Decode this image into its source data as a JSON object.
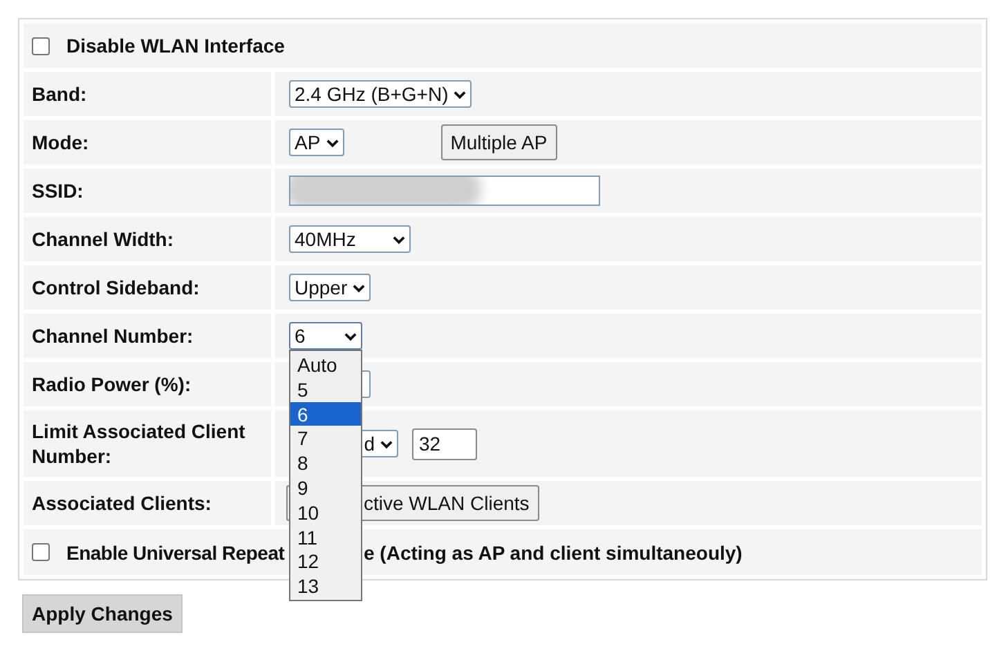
{
  "disable_wlan": {
    "label": "Disable WLAN Interface",
    "checked": false
  },
  "fields": [
    {
      "kind": "select",
      "label": "Band:",
      "value": "2.4 GHz (B+G+N)"
    },
    {
      "kind": "select_button",
      "label": "Mode:",
      "value": "AP",
      "button": "Multiple AP"
    },
    {
      "kind": "redacted_text",
      "label": "SSID:"
    },
    {
      "kind": "select",
      "label": "Channel Width:",
      "value": "40MHz"
    },
    {
      "kind": "select",
      "label": "Control Sideband:",
      "value": "Upper"
    },
    {
      "kind": "open_select",
      "label": "Channel Number:",
      "value": "6"
    },
    {
      "kind": "covered_select",
      "label": "Radio Power (%):"
    },
    {
      "kind": "select_input",
      "label": "Limit Associated Client Number:",
      "value": "d",
      "input": "32"
    },
    {
      "kind": "button",
      "label": "Associated Clients:",
      "button": "ctive WLAN Clients"
    }
  ],
  "channel_options": [
    {
      "label": "Auto",
      "selected": false
    },
    {
      "label": "5",
      "selected": false
    },
    {
      "label": "6",
      "selected": true
    },
    {
      "label": "7",
      "selected": false
    },
    {
      "label": "8",
      "selected": false
    },
    {
      "label": "9",
      "selected": false
    },
    {
      "label": "10",
      "selected": false
    },
    {
      "label": "11",
      "selected": false
    },
    {
      "label": "12",
      "selected": false
    },
    {
      "label": "13",
      "selected": false
    }
  ],
  "repeater": {
    "checked": false,
    "label_parts": [
      "Enable Universal Repeat",
      "e (Acting as AP and client simultaneouly)"
    ]
  },
  "apply_button": "Apply Changes"
}
